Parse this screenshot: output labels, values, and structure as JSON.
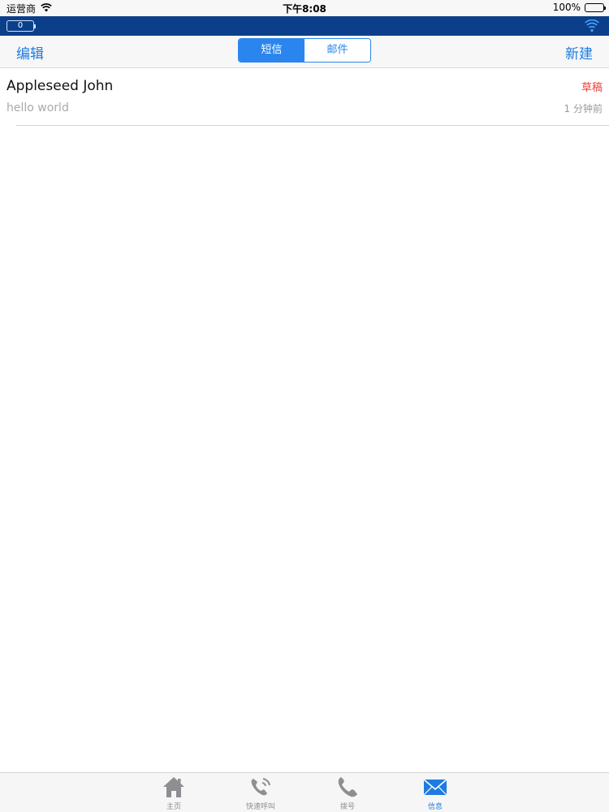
{
  "status_bar": {
    "carrier": "运营商",
    "time": "下午8:08",
    "battery_percent": "100%",
    "wifi_icon": "wifi-icon",
    "battery_icon": "battery-icon"
  },
  "blue_bar": {
    "counter": "0",
    "signal_icon": "wifi-icon",
    "color": "#0b3f8a"
  },
  "navbar": {
    "left_button": "编辑",
    "right_button": "新建",
    "segments": [
      "短信",
      "邮件"
    ],
    "selected_segment": "短信"
  },
  "messages": [
    {
      "name": "Appleseed John",
      "preview": "hello world",
      "status": "草稿",
      "time": "1 分钟前"
    }
  ],
  "tabbar": {
    "tabs": [
      {
        "label": "主页",
        "icon": "home-icon"
      },
      {
        "label": "快速呼叫",
        "icon": "speed-dial-icon"
      },
      {
        "label": "拨号",
        "icon": "phone-icon"
      },
      {
        "label": "信息",
        "icon": "mail-icon"
      }
    ],
    "active_tab": "信息"
  },
  "colors": {
    "accent": "#1e7be0",
    "draft_status": "#e8453c"
  }
}
